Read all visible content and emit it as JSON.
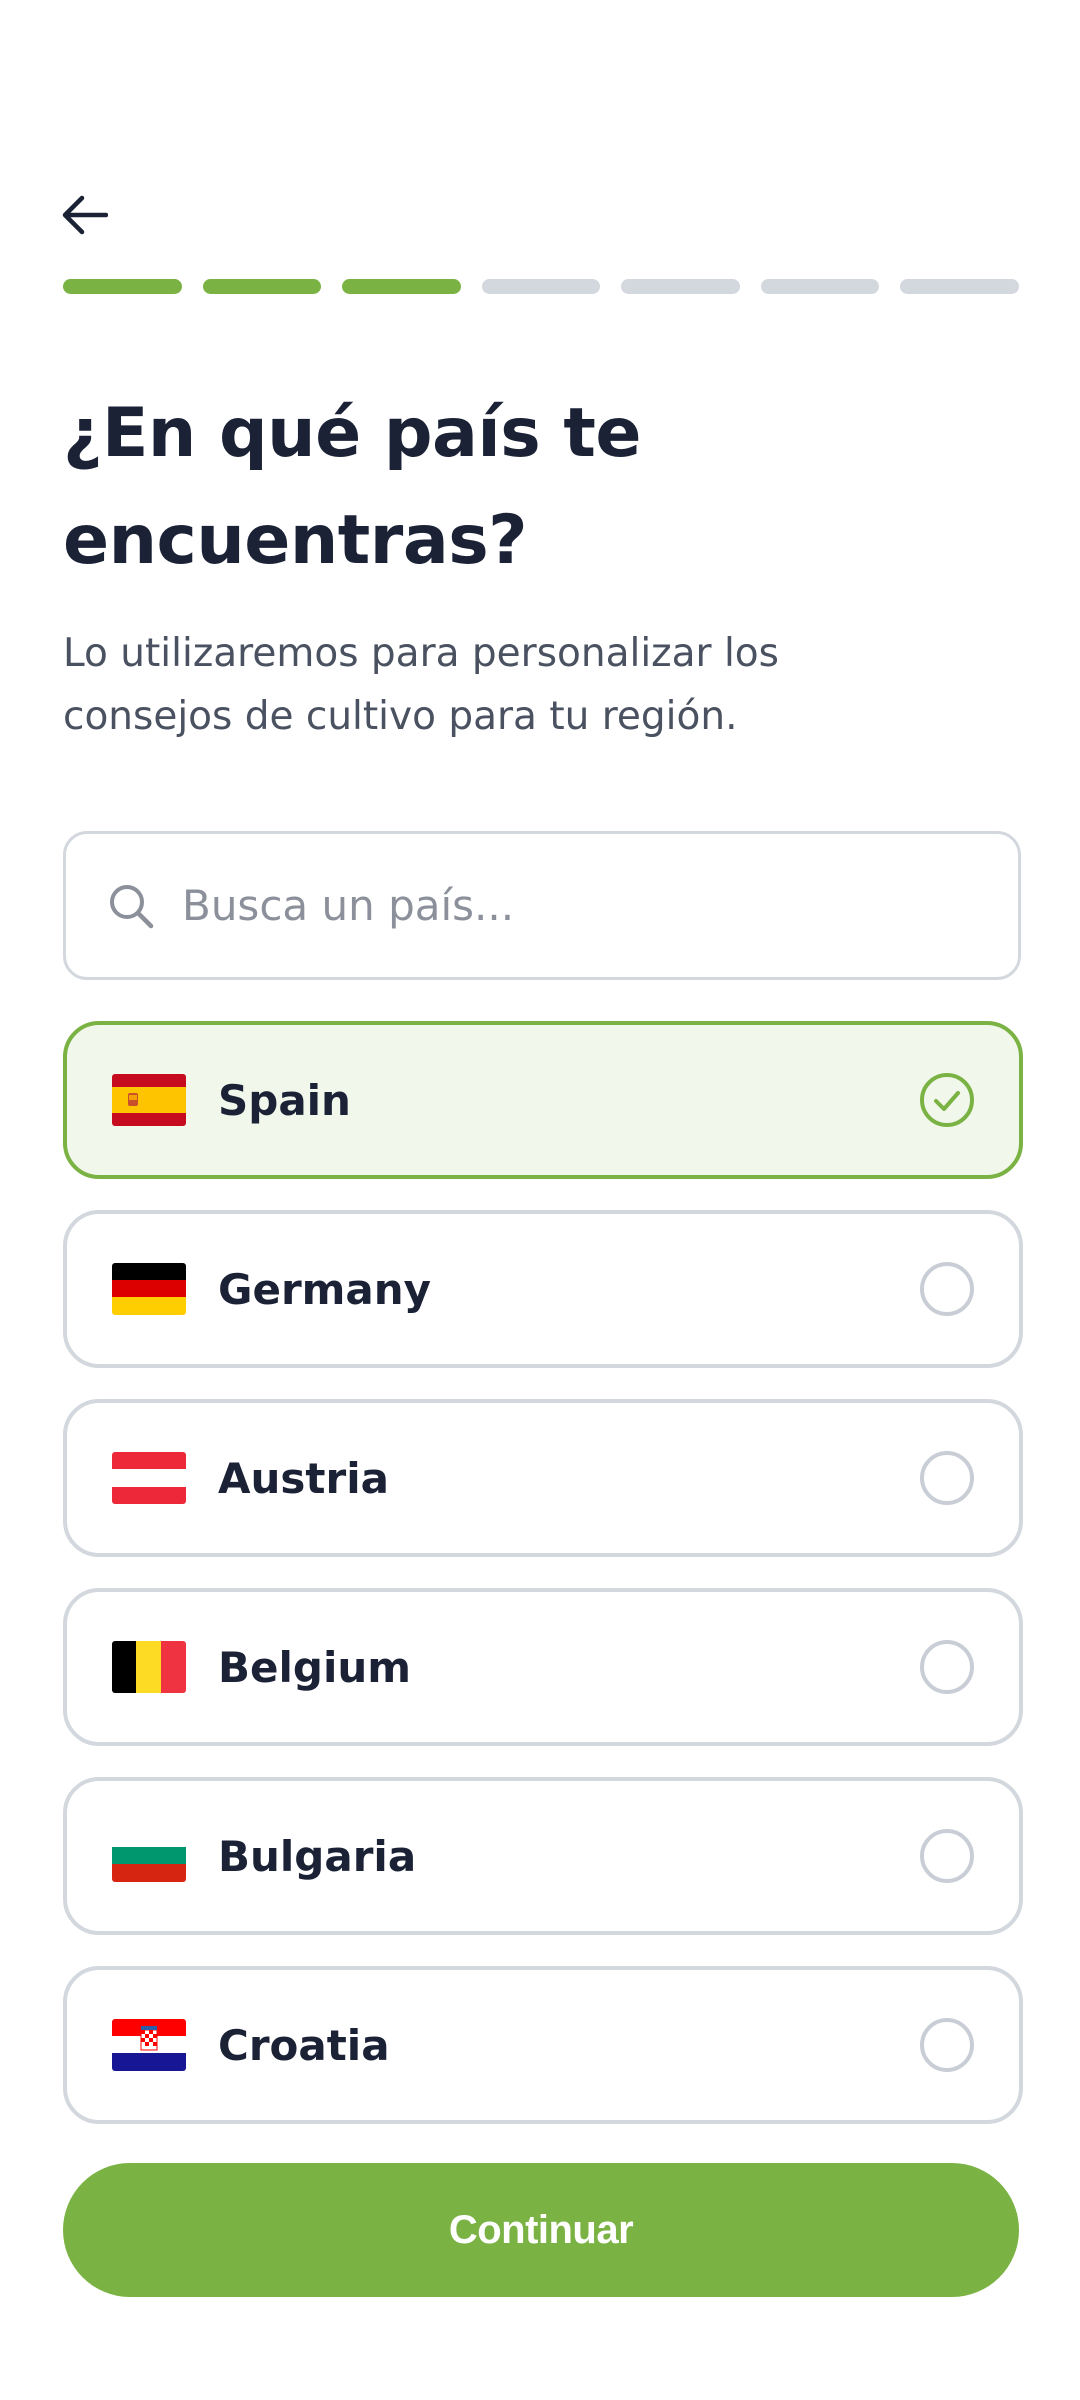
{
  "header": {
    "back_icon": "arrow-left-icon",
    "progress": {
      "completed_steps": 3,
      "total_steps": 7
    }
  },
  "title": "¿En qué país te encuentras?",
  "subtitle": "Lo utilizaremos para personalizar los consejos de cultivo para tu región.",
  "search": {
    "icon": "search-icon",
    "placeholder": "Busca un país...",
    "value": ""
  },
  "countries": [
    {
      "name": "Spain",
      "flag": "spain-flag-icon",
      "selected": true
    },
    {
      "name": "Germany",
      "flag": "germany-flag-icon",
      "selected": false
    },
    {
      "name": "Austria",
      "flag": "austria-flag-icon",
      "selected": false
    },
    {
      "name": "Belgium",
      "flag": "belgium-flag-icon",
      "selected": false
    },
    {
      "name": "Bulgaria",
      "flag": "bulgaria-flag-icon",
      "selected": false
    },
    {
      "name": "Croatia",
      "flag": "croatia-flag-icon",
      "selected": false
    }
  ],
  "continue_label": "Continuar",
  "colors": {
    "accent": "#7ab343",
    "selected_bg": "#f1f7eb",
    "border": "#d3d8de",
    "text": "#1b2236",
    "muted": "#4a5160"
  }
}
